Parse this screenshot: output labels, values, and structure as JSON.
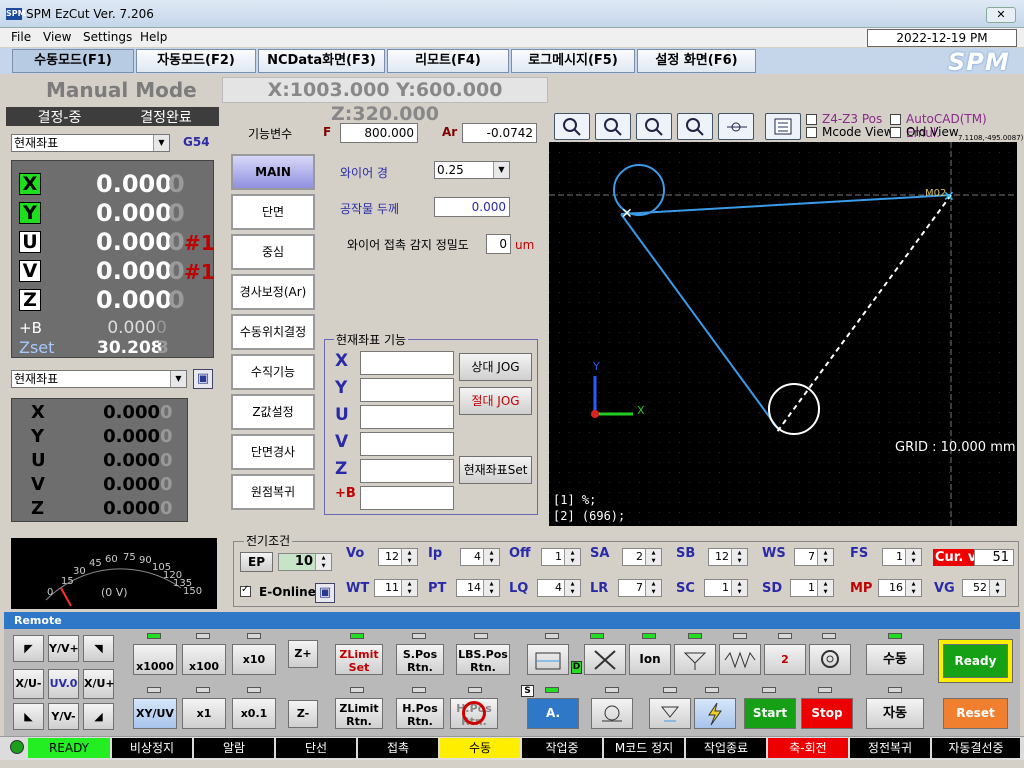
{
  "window": {
    "title": "SPM EzCut Ver. 7.206",
    "icon_text": "SPM",
    "close": "✕"
  },
  "menu": [
    "File",
    "View",
    "Settings",
    "Help"
  ],
  "datetime": "2022-12-19 PM 07:09:17",
  "tabs": [
    "수동모드(F1)",
    "자동모드(F2)",
    "NCData화면(F3)",
    "리모트(F4)",
    "로그메시지(F5)",
    "설정 화면(F6)"
  ],
  "logo": "SPM",
  "mode": "Manual Mode",
  "coord_readout": "X:1003.000 Y:600.000 Z:320.000",
  "search": {
    "left": "결정-중",
    "right": "결정완료"
  },
  "coord_select_top": {
    "value": "현재좌표",
    "code": "G54"
  },
  "axes_top": [
    {
      "name": "X",
      "value": "0.000",
      "ghost": "0",
      "hash": ""
    },
    {
      "name": "Y",
      "value": "0.000",
      "ghost": "0",
      "hash": ""
    },
    {
      "name": "U",
      "value": "0.000",
      "ghost": "0",
      "hash": "#1"
    },
    {
      "name": "V",
      "value": "0.000",
      "ghost": "0",
      "hash": "#1"
    },
    {
      "name": "Z",
      "value": "0.000",
      "ghost": "0",
      "hash": ""
    }
  ],
  "b_row": {
    "label": "+B",
    "value": "0.000",
    "ghost": "0"
  },
  "zset_row": {
    "label": "Zset",
    "value": "30.208",
    "ghost": "3"
  },
  "coord_select_bottom": {
    "value": "현재좌표"
  },
  "axes_bottom": [
    {
      "name": "X",
      "value": "0.000",
      "ghost": "0"
    },
    {
      "name": "Y",
      "value": "0.000",
      "ghost": "0"
    },
    {
      "name": "U",
      "value": "0.000",
      "ghost": "0"
    },
    {
      "name": "V",
      "value": "0.000",
      "ghost": "0"
    },
    {
      "name": "Z",
      "value": "0.000",
      "ghost": "0"
    }
  ],
  "func": {
    "label": "기능변수",
    "f_label": "F",
    "f_value": "800.000",
    "ar_label": "Ar",
    "ar_value": "-0.0742"
  },
  "func_buttons": [
    "MAIN",
    "단면",
    "중심",
    "경사보정(Ar)",
    "수동위치결정",
    "수직기능",
    "Z값설정",
    "단면경사",
    "원점복귀"
  ],
  "wire": {
    "label": "와이어 경",
    "value": "0.25"
  },
  "work": {
    "label": "공작물 두께",
    "value": "0.000"
  },
  "touch": {
    "label": "와이어 접촉 감지 정밀도",
    "value": "0",
    "unit": "um"
  },
  "cur_coord": {
    "title": "현재좌표 기능",
    "axes": [
      "X",
      "Y",
      "U",
      "V",
      "Z",
      "+B"
    ],
    "rel_jog": "상대 JOG",
    "abs_jog": "절대 JOG",
    "set": "현재좌표Set"
  },
  "view": {
    "z4z3": "Z4-Z3 Pos",
    "mcode": "Mcode View",
    "autocad": "AutoCAD(TM) Emul.",
    "oldview": "Old View",
    "coord_small": "7.1108,-495.0087)",
    "m02": "M02",
    "grid": "GRID : 10.000 mm",
    "axis_x": "X",
    "axis_y": "Y",
    "log1": "[1] %;",
    "log2": "[2] (696);",
    "toolbar": [
      "zoom-fit-icon",
      "zoom-100-icon",
      "zoom-box-icon",
      "zoom-out-icon",
      "move-icon",
      "list-icon"
    ]
  },
  "meter": {
    "ticks": [
      "0",
      "15",
      "30",
      "45",
      "60",
      "75",
      "90",
      "105",
      "120",
      "135",
      "150"
    ],
    "reading": "(0 V)"
  },
  "ec": {
    "title": "전기조건",
    "ep": "EP",
    "ep_value": "10",
    "e_online": "E-Online",
    "row1": [
      {
        "l": "Vo",
        "v": "12"
      },
      {
        "l": "Ip",
        "v": "4"
      },
      {
        "l": "Off",
        "v": "1"
      },
      {
        "l": "SA",
        "v": "2"
      },
      {
        "l": "SB",
        "v": "12"
      },
      {
        "l": "WS",
        "v": "7"
      },
      {
        "l": "FS",
        "v": "1"
      }
    ],
    "curv_label": "Cur. v",
    "curv_value": "51",
    "row2": [
      {
        "l": "WT",
        "v": "11"
      },
      {
        "l": "PT",
        "v": "14"
      },
      {
        "l": "LQ",
        "v": "4"
      },
      {
        "l": "LR",
        "v": "7"
      },
      {
        "l": "SC",
        "v": "1"
      },
      {
        "l": "SD",
        "v": "1"
      },
      {
        "l": "MP",
        "v": "16"
      },
      {
        "l": "VG",
        "v": "52"
      }
    ]
  },
  "remote": {
    "title": "Remote",
    "jog": {
      "yvp": "Y/V+",
      "xum": "X/U-",
      "uv0": "UV.0",
      "xup": "X/U+",
      "yvm": "Y/V-"
    },
    "mult": {
      "x1000": "x1000",
      "x100": "x100",
      "x10": "x10",
      "xyuv": "XY/UV",
      "x1": "x1",
      "x01": "x0.1",
      "zp": "Z+",
      "zm": "Z-"
    },
    "zlimit_set": "ZLimit Set",
    "spos": "S.Pos Rtn.",
    "lbspos": "LBS.Pos Rtn.",
    "zlimit_rtn": "ZLimit Rtn.",
    "hpos": "H.Pos Rtn.",
    "hpos2": "H.Pos Rtn.",
    "d_tag": "D",
    "s_tag": "S",
    "ion": "Ion",
    "two": "2",
    "astart": "A. Start",
    "start": "Start",
    "stop": "Stop",
    "manual": "수동",
    "auto": "자동",
    "ready": "Ready",
    "reset": "Reset"
  },
  "status": [
    {
      "t": "READY",
      "bg": "#22ee22",
      "fg": "#000"
    },
    {
      "t": "비상정지",
      "bg": "#000",
      "fg": "#fff"
    },
    {
      "t": "알람",
      "bg": "#000",
      "fg": "#fff"
    },
    {
      "t": "단선",
      "bg": "#000",
      "fg": "#fff"
    },
    {
      "t": "접촉",
      "bg": "#000",
      "fg": "#fff"
    },
    {
      "t": "수동",
      "bg": "#ffee00",
      "fg": "#000"
    },
    {
      "t": "작업중",
      "bg": "#000",
      "fg": "#fff"
    },
    {
      "t": "M코드 정지",
      "bg": "#000",
      "fg": "#fff"
    },
    {
      "t": "작업종료",
      "bg": "#000",
      "fg": "#fff"
    },
    {
      "t": "축-회전",
      "bg": "#ee0000",
      "fg": "#fff"
    },
    {
      "t": "정전복귀",
      "bg": "#000",
      "fg": "#fff"
    },
    {
      "t": "자동결선중",
      "bg": "#000",
      "fg": "#fff"
    }
  ],
  "colors": {
    "accent": "#2f78c8",
    "ready_green": "#22ee22",
    "manual_yellow": "#ffee00",
    "path_blue": "#3a9be8",
    "stop_red": "#ee0000",
    "reset_orange": "#f08030"
  }
}
